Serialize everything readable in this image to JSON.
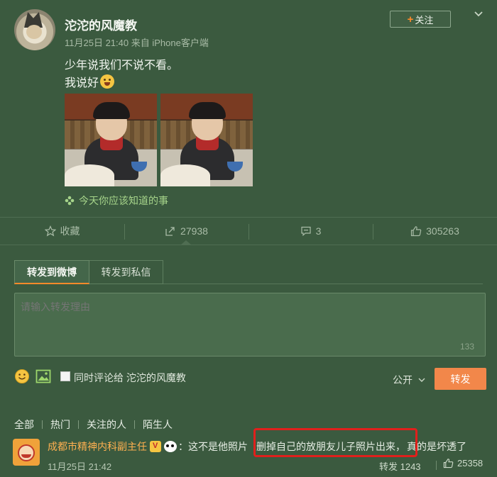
{
  "post": {
    "username": "沱沱的风魔教",
    "time": "11月25日 21:40",
    "source": "来自 iPhone客户端",
    "follow_label": "关注",
    "text_line1": "少年说我们不说不看。",
    "text_line2": "我说好",
    "link_text": "今天你应该知道的事"
  },
  "actions": {
    "favorite_label": "收藏",
    "repost_count": "27938",
    "comment_count": "3",
    "like_count": "305263"
  },
  "repost": {
    "tab_weibo": "转发到微博",
    "tab_private": "转发到私信",
    "placeholder": "请输入转发理由",
    "remaining": "133",
    "also_comment": "同时评论给 沱沱的风魔教",
    "visibility": "公开",
    "submit_label": "转发"
  },
  "comments": {
    "filters": [
      "全部",
      "热门",
      "关注的人",
      "陌生人"
    ],
    "first": {
      "user": "成都市精神内科副主任",
      "text_before": "：这不是他照片",
      "text_highlight": "删掉自己的放朋友儿子照片出来，",
      "text_after": "真的是坏透了",
      "time": "11月25日 21:42",
      "repost": "转发 1243",
      "likes": "25358"
    }
  },
  "colors": {
    "background": "#3b5a3f",
    "accent": "#f2874a",
    "link": "#a6d48a",
    "highlight_box": "#e0201c"
  }
}
